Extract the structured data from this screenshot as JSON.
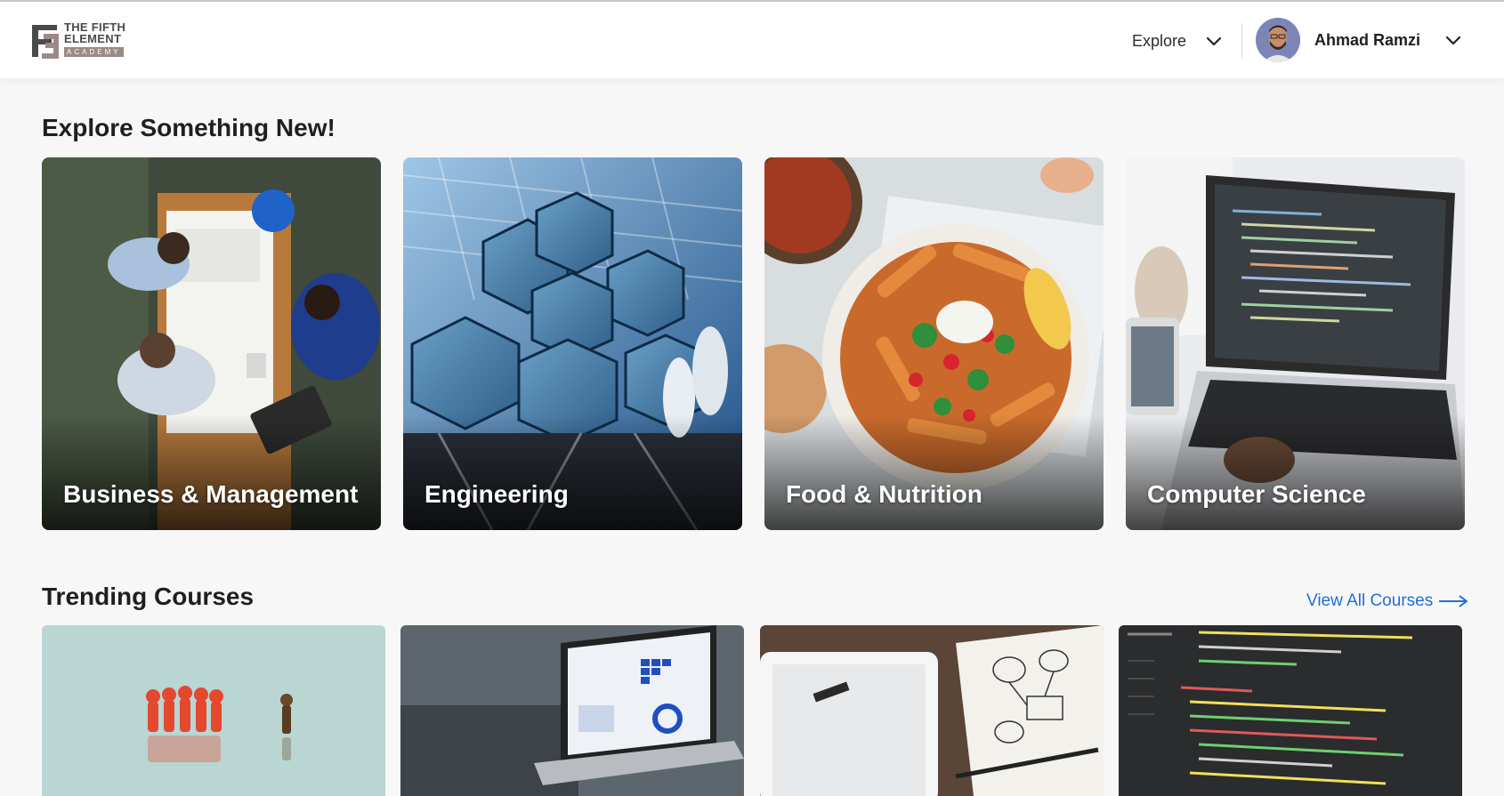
{
  "header": {
    "logo": {
      "line1": "THE FIFTH",
      "line2": "ELEMENT",
      "line3": "ACADEMY"
    },
    "explore_label": "Explore",
    "user_name": "Ahmad Ramzi",
    "icons": {
      "explore_chevron": "chevron-down-icon",
      "user_chevron": "chevron-down-icon",
      "avatar": "user-avatar"
    }
  },
  "explore_section": {
    "title": "Explore Something New!",
    "categories": [
      {
        "label": "Business & Management"
      },
      {
        "label": "Engineering"
      },
      {
        "label": "Food & Nutrition"
      },
      {
        "label": "Computer Science"
      }
    ]
  },
  "trending_section": {
    "title": "Trending Courses",
    "view_all_label": "View All Courses",
    "view_all_icon": "arrow-right-icon"
  },
  "colors": {
    "accent": "#1e6fd9",
    "background": "#f7f7f7",
    "header_bg": "#ffffff"
  }
}
